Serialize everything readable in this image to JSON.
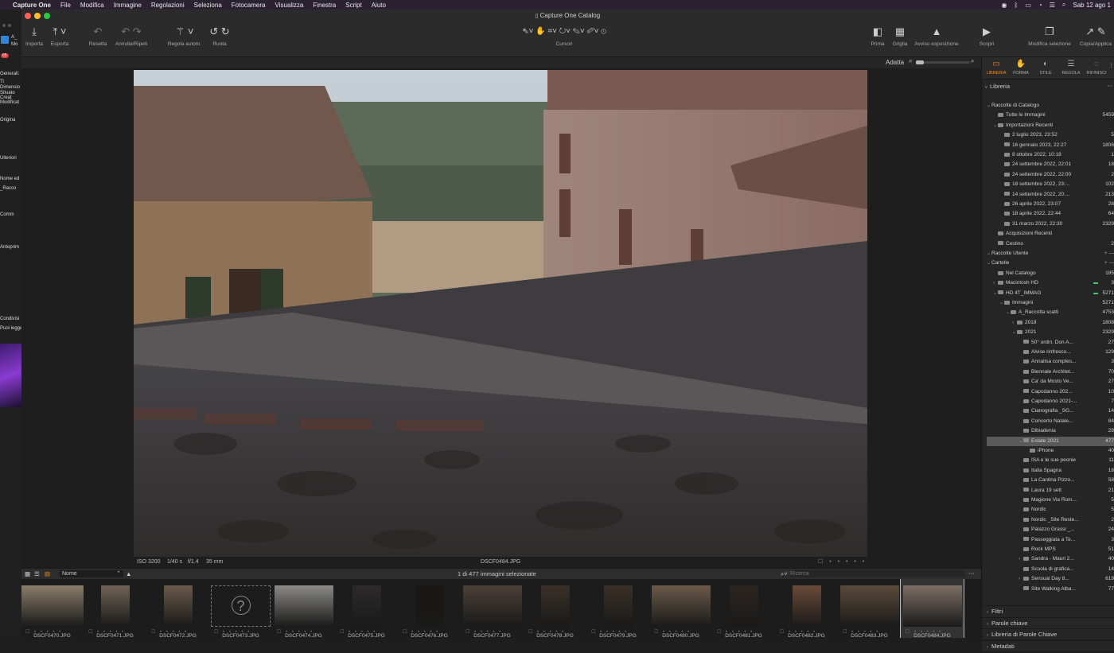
{
  "menubar": {
    "app": "Capture One",
    "items": [
      "File",
      "Modifica",
      "Immagine",
      "Regolazioni",
      "Seleziona",
      "Fotocamera",
      "Visualizza",
      "Finestra",
      "Script",
      "Aiuto"
    ],
    "clock": "Sab 12 ago 1"
  },
  "left_strip": {
    "texts": [
      "A_",
      "Mo",
      "Generali:",
      "Ti",
      "Dimensio",
      "Situato",
      "Creat",
      "Modificat",
      "Origina",
      "Ulteriori",
      "Nome ed",
      "_Racco",
      "Comm",
      "Anteprim",
      "Condivisi",
      "Puoi legge"
    ],
    "badge": "65"
  },
  "window": {
    "title": "Capture One Catalog"
  },
  "toolbar": {
    "left": [
      {
        "label": "Importa",
        "icon": "import-icon"
      },
      {
        "label": "Esporta",
        "icon": "export-icon"
      },
      {
        "label": "Resetta",
        "icon": "reset-icon"
      },
      {
        "label": "Annulla/Ripeti",
        "icon": "undo-icon"
      },
      {
        "label": "Regola autom.",
        "icon": "auto-adjust-icon"
      },
      {
        "label": "Ruota",
        "icon": "rotate-icon"
      }
    ],
    "cursors_label": "Cursori",
    "right": [
      {
        "label": "Prima",
        "icon": "before-icon"
      },
      {
        "label": "Griglia",
        "icon": "grid-icon"
      },
      {
        "label": "Avviso esposizione",
        "icon": "exposure-warning-icon"
      },
      {
        "label": "Scopri",
        "icon": "reveal-icon"
      },
      {
        "label": "Modifica selezione",
        "icon": "edit-selection-icon"
      },
      {
        "label": "Copia/Applica",
        "icon": "copy-apply-icon"
      }
    ]
  },
  "viewer": {
    "zoom_label": "Adatta",
    "iso": "ISO 3200",
    "shutter": "1/40 s",
    "aperture": "f/1.4",
    "focal": "35 mm",
    "filename": "DSCF0484.JPG"
  },
  "browser": {
    "sort_label": "Nome",
    "selection_status": "1 di 477 immagini selezionate",
    "search_placeholder": "Ricerca"
  },
  "filmstrip": [
    "DSCF0470.JPG",
    "DSCF0471.JPG",
    "DSCF0472.JPG",
    "DSCF0473.JPG",
    "DSCF0474.JPG",
    "DSCF0475.JPG",
    "DSCF0476.JPG",
    "DSCF0477.JPG",
    "DSCF0478.JPG",
    "DSCF0479.JPG",
    "DSCF0480.JPG",
    "DSCF0481.JPG",
    "DSCF0482.JPG",
    "DSCF0483.JPG",
    "DSCF0484.JPG"
  ],
  "right_panel": {
    "tabs": [
      "LIBRERIA",
      "FORMA",
      "STILE",
      "REGOLA",
      "RIFINISCI"
    ],
    "library_title": "Libreria",
    "tree": [
      {
        "label": "Raccolte di Catalogo",
        "count": "",
        "indent": 1,
        "tri": "v",
        "folder": false
      },
      {
        "label": "Tutte le Immagini",
        "count": "5459",
        "indent": 2,
        "tri": "",
        "folder": true
      },
      {
        "label": "Importazioni Recenti",
        "count": "",
        "indent": 2,
        "tri": "v",
        "folder": true
      },
      {
        "label": "2 luglio 2023, 23:52",
        "count": "5",
        "indent": 3,
        "tri": "",
        "folder": true
      },
      {
        "label": "16 gennaio 2023, 22:27",
        "count": "1806",
        "indent": 3,
        "tri": "",
        "folder": true
      },
      {
        "label": "8 ottobre 2022, 10:18",
        "count": "1",
        "indent": 3,
        "tri": "",
        "folder": true
      },
      {
        "label": "24 settembre 2022, 22:01",
        "count": "18",
        "indent": 3,
        "tri": "",
        "folder": true
      },
      {
        "label": "24 settembre 2022, 22:00",
        "count": "2",
        "indent": 3,
        "tri": "",
        "folder": true
      },
      {
        "label": "18 settembre 2022, 23:...",
        "count": "102",
        "indent": 3,
        "tri": "",
        "folder": true
      },
      {
        "label": "14 settembre 2022, 20:...",
        "count": "213",
        "indent": 3,
        "tri": "",
        "folder": true
      },
      {
        "label": "26 aprile 2022, 23:07",
        "count": "28",
        "indent": 3,
        "tri": "",
        "folder": true
      },
      {
        "label": "18 aprile 2022, 22:44",
        "count": "64",
        "indent": 3,
        "tri": "",
        "folder": true
      },
      {
        "label": "31 marzo 2022, 22:30",
        "count": "2329",
        "indent": 3,
        "tri": "",
        "folder": true
      },
      {
        "label": "Acquisizioni Recenti",
        "count": "",
        "indent": 2,
        "tri": "",
        "folder": true
      },
      {
        "label": "Cestino",
        "count": "2",
        "indent": 2,
        "tri": "",
        "folder": true
      },
      {
        "label": "Raccolte Utente",
        "count": "",
        "indent": 1,
        "tri": "v",
        "folder": false,
        "header": true
      },
      {
        "label": "Cartelle",
        "count": "",
        "indent": 1,
        "tri": "v",
        "folder": false,
        "header": true
      },
      {
        "label": "Nel Catalogo",
        "count": "185",
        "indent": 2,
        "tri": "",
        "folder": true
      },
      {
        "label": "Macintosh HD",
        "count": "3",
        "indent": 2,
        "tri": ">",
        "folder": true,
        "green": true
      },
      {
        "label": "HD 4T_IMMAG",
        "count": "5271",
        "indent": 2,
        "tri": "v",
        "folder": true,
        "green": true
      },
      {
        "label": "Immagini",
        "count": "5271",
        "indent": 3,
        "tri": "v",
        "folder": true
      },
      {
        "label": "A_Raccolta scatti",
        "count": "4753",
        "indent": 4,
        "tri": "v",
        "folder": true
      },
      {
        "label": "2018",
        "count": "1808",
        "indent": 5,
        "tri": ">",
        "folder": true
      },
      {
        "label": "2021",
        "count": "2329",
        "indent": 5,
        "tri": "v",
        "folder": true
      },
      {
        "label": "50° ordin. Don A...",
        "count": "27",
        "indent": 6,
        "tri": "",
        "folder": true
      },
      {
        "label": "Alvise rinfresco...",
        "count": "129",
        "indent": 6,
        "tri": "",
        "folder": true
      },
      {
        "label": "Annalisa comples...",
        "count": "3",
        "indent": 6,
        "tri": "",
        "folder": true
      },
      {
        "label": "Biennale Architet...",
        "count": "70",
        "indent": 6,
        "tri": "",
        "folder": true
      },
      {
        "label": "Ca' da Mosto Ve...",
        "count": "27",
        "indent": 6,
        "tri": "",
        "folder": true
      },
      {
        "label": "Capodanno 202...",
        "count": "10",
        "indent": 6,
        "tri": "",
        "folder": true
      },
      {
        "label": "Capodanno 2021-...",
        "count": "7",
        "indent": 6,
        "tri": "",
        "folder": true
      },
      {
        "label": "Cianografia _SG...",
        "count": "14",
        "indent": 6,
        "tri": "",
        "folder": true
      },
      {
        "label": "Concerto Natale...",
        "count": "84",
        "indent": 6,
        "tri": "",
        "folder": true
      },
      {
        "label": "Dibiadenia",
        "count": "28",
        "indent": 6,
        "tri": "",
        "folder": true
      },
      {
        "label": "Estate 2021",
        "count": "477",
        "indent": 6,
        "tri": "v",
        "folder": true,
        "selected": true
      },
      {
        "label": "iPhone",
        "count": "40",
        "indent": 7,
        "tri": "",
        "folder": true
      },
      {
        "label": "ISA e le sue peonie",
        "count": "11",
        "indent": 6,
        "tri": "",
        "folder": true
      },
      {
        "label": "Italia Spagna",
        "count": "18",
        "indent": 6,
        "tri": "",
        "folder": true
      },
      {
        "label": "La Cantina Pizzo...",
        "count": "58",
        "indent": 6,
        "tri": "",
        "folder": true
      },
      {
        "label": "Laura 19 sett",
        "count": "21",
        "indent": 6,
        "tri": "",
        "folder": true
      },
      {
        "label": "Magione Via Rom...",
        "count": "5",
        "indent": 6,
        "tri": "",
        "folder": true
      },
      {
        "label": "Nordic",
        "count": "5",
        "indent": 6,
        "tri": "",
        "folder": true
      },
      {
        "label": "Nordic _Site Reste...",
        "count": "2",
        "indent": 6,
        "tri": "",
        "folder": true
      },
      {
        "label": "Palazzo Grassi _...",
        "count": "24",
        "indent": 6,
        "tri": "",
        "folder": true
      },
      {
        "label": "Passeggiata a Te...",
        "count": "3",
        "indent": 6,
        "tri": "",
        "folder": true
      },
      {
        "label": "Rock MPS",
        "count": "51",
        "indent": 6,
        "tri": "",
        "folder": true
      },
      {
        "label": "Sandra - Mauri 2...",
        "count": "40",
        "indent": 6,
        "tri": ">",
        "folder": true
      },
      {
        "label": "Scuola di grafica...",
        "count": "14",
        "indent": 6,
        "tri": "",
        "folder": true
      },
      {
        "label": "Sensual Day 8...",
        "count": "619",
        "indent": 6,
        "tri": ">",
        "folder": true
      },
      {
        "label": "Site Walking Alba...",
        "count": "77",
        "indent": 6,
        "tri": "",
        "folder": true
      }
    ],
    "bottom_sections": [
      "Filtri",
      "Parole chiave",
      "Libreria di Parole Chiave",
      "Metadati"
    ]
  }
}
